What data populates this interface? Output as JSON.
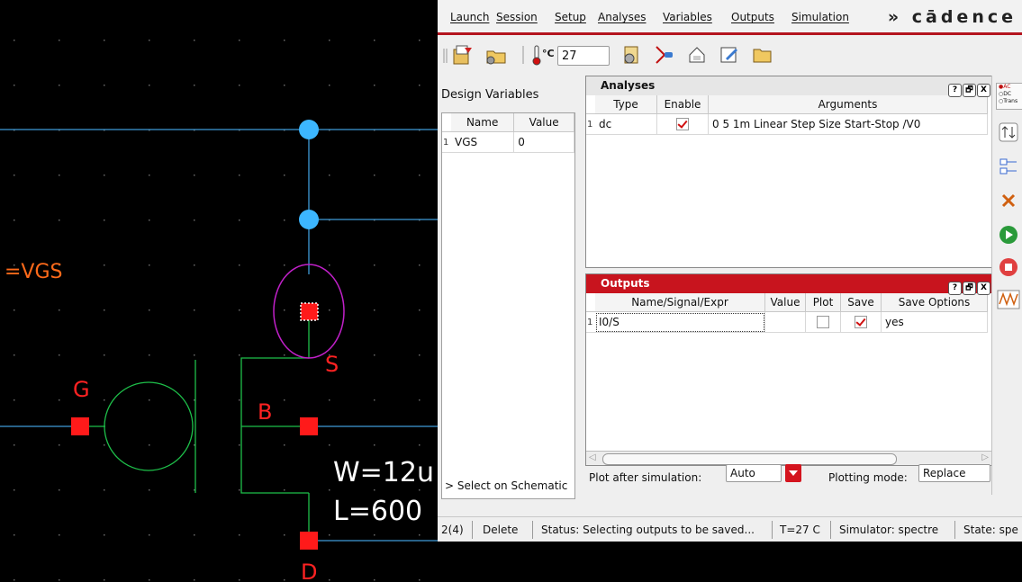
{
  "schematic": {
    "labels": {
      "vgs": "=VGS",
      "gate": "G",
      "bulk": "B",
      "source": "S",
      "drain": "D",
      "width": "W=12u",
      "length": "L=600"
    },
    "colors": {
      "wire": "#3f9bd8",
      "device": "#1ec04a",
      "pin": "#ff1a1a",
      "text": "#ff2222",
      "selection": "#c020c8",
      "param": "#ffffff",
      "node": "#3cb6ff"
    }
  },
  "ade": {
    "menu": [
      "Launch",
      "Session",
      "Setup",
      "Analyses",
      "Variables",
      "Outputs",
      "Simulation"
    ],
    "brand": "» cādence",
    "toolbar": {
      "temperature_unit": "°C",
      "temperature": "27"
    },
    "design_variables": {
      "title": "Design Variables",
      "columns": [
        "Name",
        "Value"
      ],
      "rows": [
        {
          "index": "1",
          "name": "VGS",
          "value": "0"
        }
      ],
      "select_link": "> Select on Schematic"
    },
    "analyses": {
      "title": "Analyses",
      "columns": [
        "Type",
        "Enable",
        "Arguments"
      ],
      "rows": [
        {
          "index": "1",
          "type": "dc",
          "enabled": true,
          "arguments": "0 5 1m Linear Step Size Start-Stop /V0"
        }
      ]
    },
    "outputs": {
      "title": "Outputs",
      "columns": [
        "Name/Signal/Expr",
        "Value",
        "Plot",
        "Save",
        "Save Options"
      ],
      "rows": [
        {
          "index": "1",
          "name": "I0/S",
          "value": "",
          "plot": false,
          "save": true,
          "save_options": "yes"
        }
      ]
    },
    "window_buttons": [
      "?",
      "🗗",
      "X"
    ],
    "plot_after_label": "Plot after simulation:",
    "plot_after_value": "Auto",
    "plotting_mode_label": "Plotting mode:",
    "plotting_mode_value": "Replace",
    "right_strip": {
      "radio_labels": [
        "AC",
        "DC",
        "Trans"
      ]
    },
    "status": {
      "count": "2(4)",
      "action": "Delete",
      "status": "Status: Selecting outputs to be saved...",
      "temp": "T=27 C",
      "simulator": "Simulator: spectre",
      "state": "State: spe"
    }
  }
}
